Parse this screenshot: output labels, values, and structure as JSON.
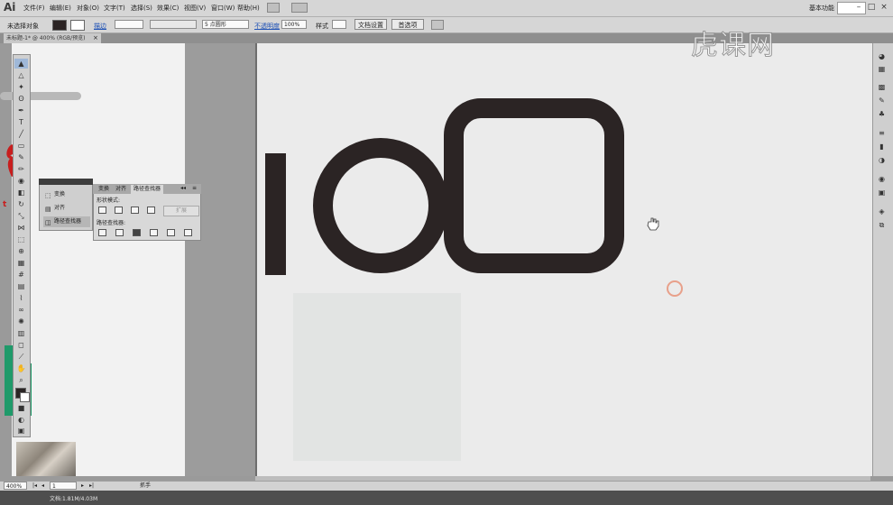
{
  "app": {
    "logo": "Ai",
    "workspace": "基本功能"
  },
  "menu": [
    "文件(F)",
    "编辑(E)",
    "对象(O)",
    "文字(T)",
    "选择(S)",
    "效果(C)",
    "视图(V)",
    "窗口(W)",
    "帮助(H)"
  ],
  "control_bar": {
    "no_selection": "未选择对象",
    "stroke_label": "描边",
    "brush_value": "5 点圆形",
    "opacity_label": "不透明度",
    "opacity_value": "100%",
    "style_label": "样式",
    "doc_setup": "文档设置",
    "preferences": "首选项"
  },
  "doc_tab": {
    "title": "未标题-1* @ 400% (RGB/预览)",
    "close": "×"
  },
  "panel_a": {
    "items": [
      "变换",
      "对齐",
      "路径查找器"
    ]
  },
  "panel_b": {
    "tabs": [
      "变换",
      "对齐",
      "路径查找器"
    ],
    "shape_modes": "形状模式:",
    "pathfinder": "路径查找器:",
    "expand": "扩展"
  },
  "status": {
    "zoom": "400%",
    "page": "1",
    "tool": "抓手",
    "doc_info": "文档:1.81M/4.03M"
  },
  "watermark": "虎课网",
  "colors": {
    "shape": "#2b2424",
    "accent_red": "#c81e1e",
    "accent_green": "#1f9a6a",
    "cursor_ring": "#e8a08a"
  }
}
